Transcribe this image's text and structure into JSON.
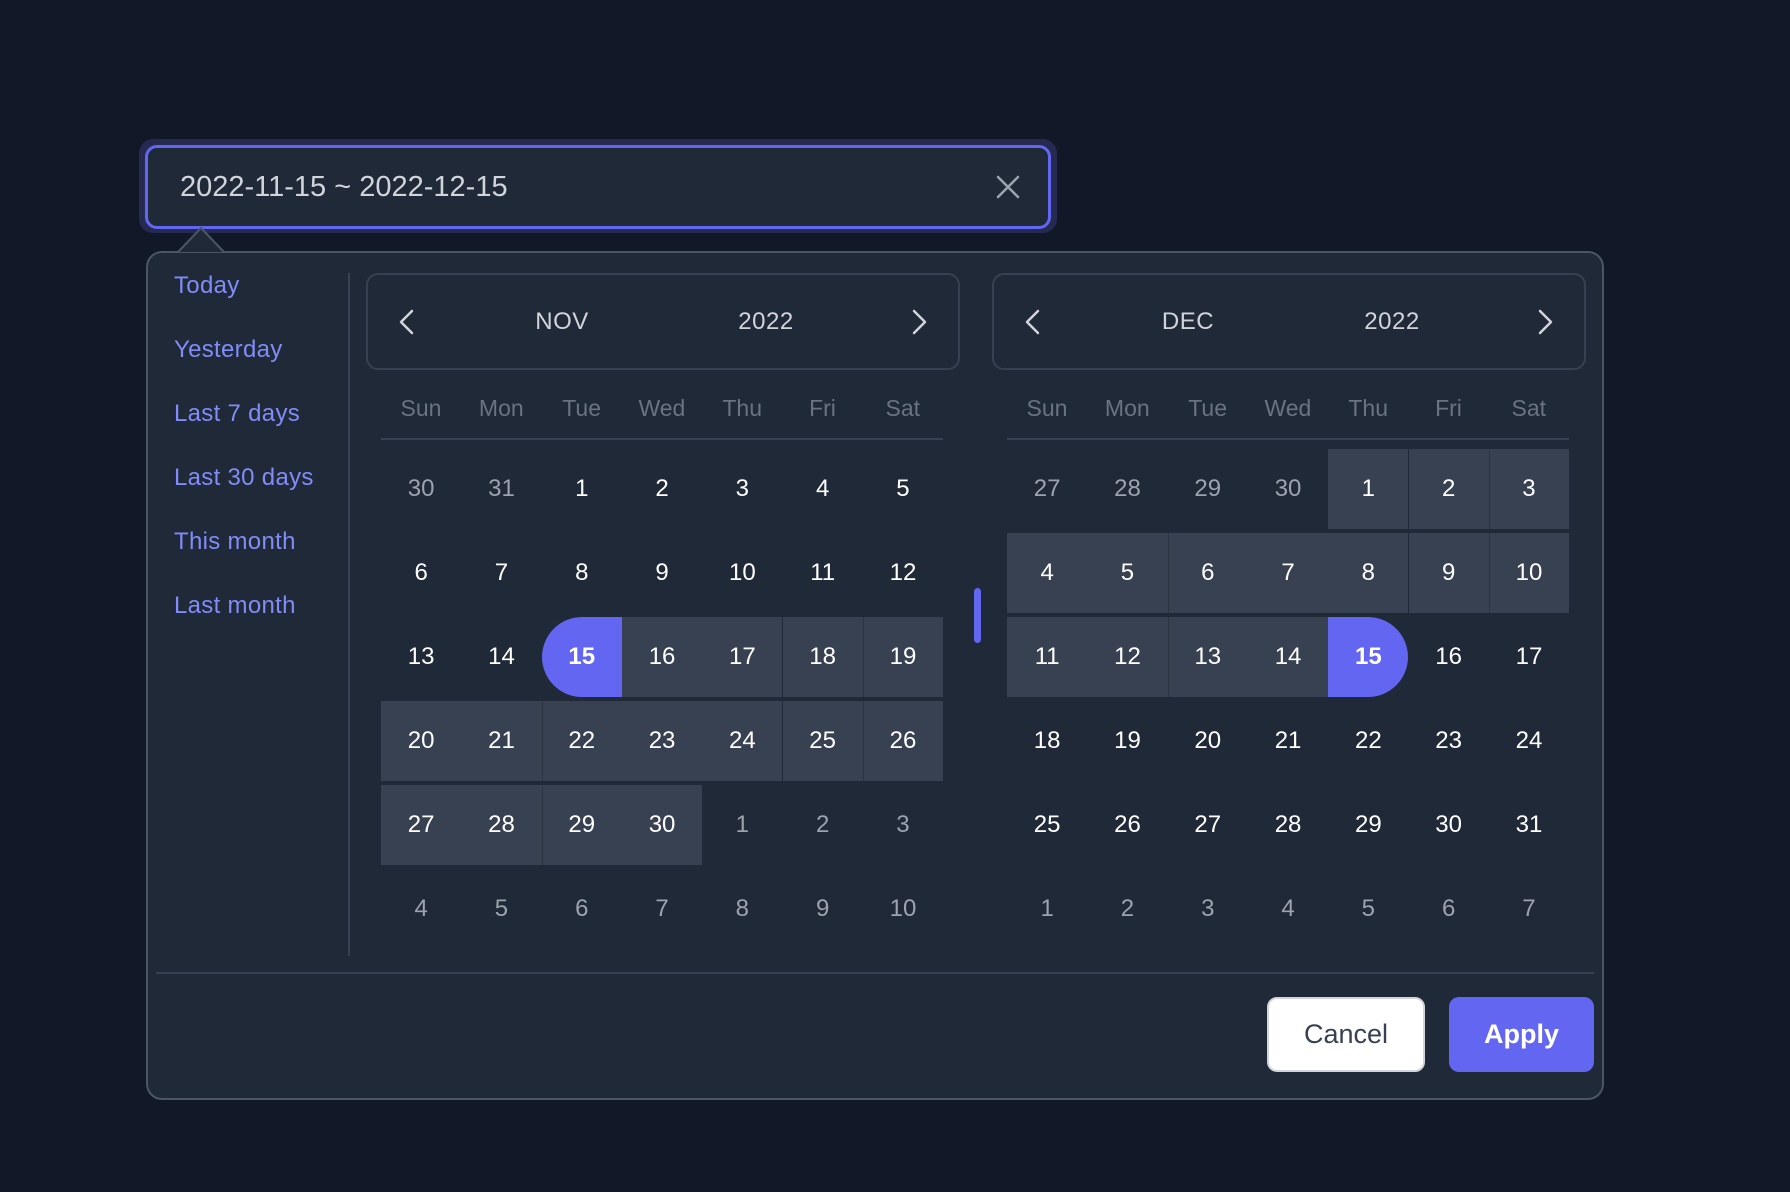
{
  "input": {
    "value": "2022-11-15 ~ 2022-12-15",
    "clear_icon": "close-icon"
  },
  "colors": {
    "accent": "#6366f1",
    "shortcut_text": "#818cf8",
    "range_bg": "#374151",
    "panel_bg": "#1f2937",
    "page_bg": "#111827"
  },
  "shortcuts": [
    {
      "label": "Today"
    },
    {
      "label": "Yesterday"
    },
    {
      "label": "Last 7 days"
    },
    {
      "label": "Last 30 days"
    },
    {
      "label": "This month"
    },
    {
      "label": "Last month"
    }
  ],
  "selection": {
    "start": "2022-11-15",
    "end": "2022-12-15"
  },
  "calendars": [
    {
      "month": "NOV",
      "year": "2022",
      "prev_icon": "chevron-left-icon",
      "next_icon": "chevron-right-icon",
      "weekdays": [
        "Sun",
        "Mon",
        "Tue",
        "Wed",
        "Thu",
        "Fri",
        "Sat"
      ],
      "weeks": [
        [
          {
            "d": "30",
            "m": true
          },
          {
            "d": "31",
            "m": true
          },
          {
            "d": "1"
          },
          {
            "d": "2"
          },
          {
            "d": "3"
          },
          {
            "d": "4"
          },
          {
            "d": "5"
          }
        ],
        [
          {
            "d": "6"
          },
          {
            "d": "7"
          },
          {
            "d": "8"
          },
          {
            "d": "9"
          },
          {
            "d": "10"
          },
          {
            "d": "11"
          },
          {
            "d": "12"
          }
        ],
        [
          {
            "d": "13"
          },
          {
            "d": "14"
          },
          {
            "d": "15",
            "s": "start"
          },
          {
            "d": "16",
            "r": true
          },
          {
            "d": "17",
            "r": true
          },
          {
            "d": "18",
            "r": true
          },
          {
            "d": "19",
            "r": true
          }
        ],
        [
          {
            "d": "20",
            "r": true
          },
          {
            "d": "21",
            "r": true
          },
          {
            "d": "22",
            "r": true
          },
          {
            "d": "23",
            "r": true
          },
          {
            "d": "24",
            "r": true
          },
          {
            "d": "25",
            "r": true
          },
          {
            "d": "26",
            "r": true
          }
        ],
        [
          {
            "d": "27",
            "r": true
          },
          {
            "d": "28",
            "r": true
          },
          {
            "d": "29",
            "r": true
          },
          {
            "d": "30",
            "r": true
          },
          {
            "d": "1",
            "m": true
          },
          {
            "d": "2",
            "m": true
          },
          {
            "d": "3",
            "m": true
          }
        ],
        [
          {
            "d": "4",
            "m": true
          },
          {
            "d": "5",
            "m": true
          },
          {
            "d": "6",
            "m": true
          },
          {
            "d": "7",
            "m": true
          },
          {
            "d": "8",
            "m": true
          },
          {
            "d": "9",
            "m": true
          },
          {
            "d": "10",
            "m": true
          }
        ]
      ]
    },
    {
      "month": "DEC",
      "year": "2022",
      "prev_icon": "chevron-left-icon",
      "next_icon": "chevron-right-icon",
      "weekdays": [
        "Sun",
        "Mon",
        "Tue",
        "Wed",
        "Thu",
        "Fri",
        "Sat"
      ],
      "weeks": [
        [
          {
            "d": "27",
            "m": true
          },
          {
            "d": "28",
            "m": true
          },
          {
            "d": "29",
            "m": true
          },
          {
            "d": "30",
            "m": true
          },
          {
            "d": "1",
            "r": true
          },
          {
            "d": "2",
            "r": true
          },
          {
            "d": "3",
            "r": true
          }
        ],
        [
          {
            "d": "4",
            "r": true
          },
          {
            "d": "5",
            "r": true
          },
          {
            "d": "6",
            "r": true
          },
          {
            "d": "7",
            "r": true
          },
          {
            "d": "8",
            "r": true
          },
          {
            "d": "9",
            "r": true
          },
          {
            "d": "10",
            "r": true
          }
        ],
        [
          {
            "d": "11",
            "r": true
          },
          {
            "d": "12",
            "r": true
          },
          {
            "d": "13",
            "r": true
          },
          {
            "d": "14",
            "r": true
          },
          {
            "d": "15",
            "s": "end"
          },
          {
            "d": "16"
          },
          {
            "d": "17"
          }
        ],
        [
          {
            "d": "18"
          },
          {
            "d": "19"
          },
          {
            "d": "20"
          },
          {
            "d": "21"
          },
          {
            "d": "22"
          },
          {
            "d": "23"
          },
          {
            "d": "24"
          }
        ],
        [
          {
            "d": "25"
          },
          {
            "d": "26"
          },
          {
            "d": "27"
          },
          {
            "d": "28"
          },
          {
            "d": "29"
          },
          {
            "d": "30"
          },
          {
            "d": "31"
          }
        ],
        [
          {
            "d": "1",
            "m": true
          },
          {
            "d": "2",
            "m": true
          },
          {
            "d": "3",
            "m": true
          },
          {
            "d": "4",
            "m": true
          },
          {
            "d": "5",
            "m": true
          },
          {
            "d": "6",
            "m": true
          },
          {
            "d": "7",
            "m": true
          }
        ]
      ]
    }
  ],
  "footer": {
    "cancel_label": "Cancel",
    "apply_label": "Apply"
  }
}
